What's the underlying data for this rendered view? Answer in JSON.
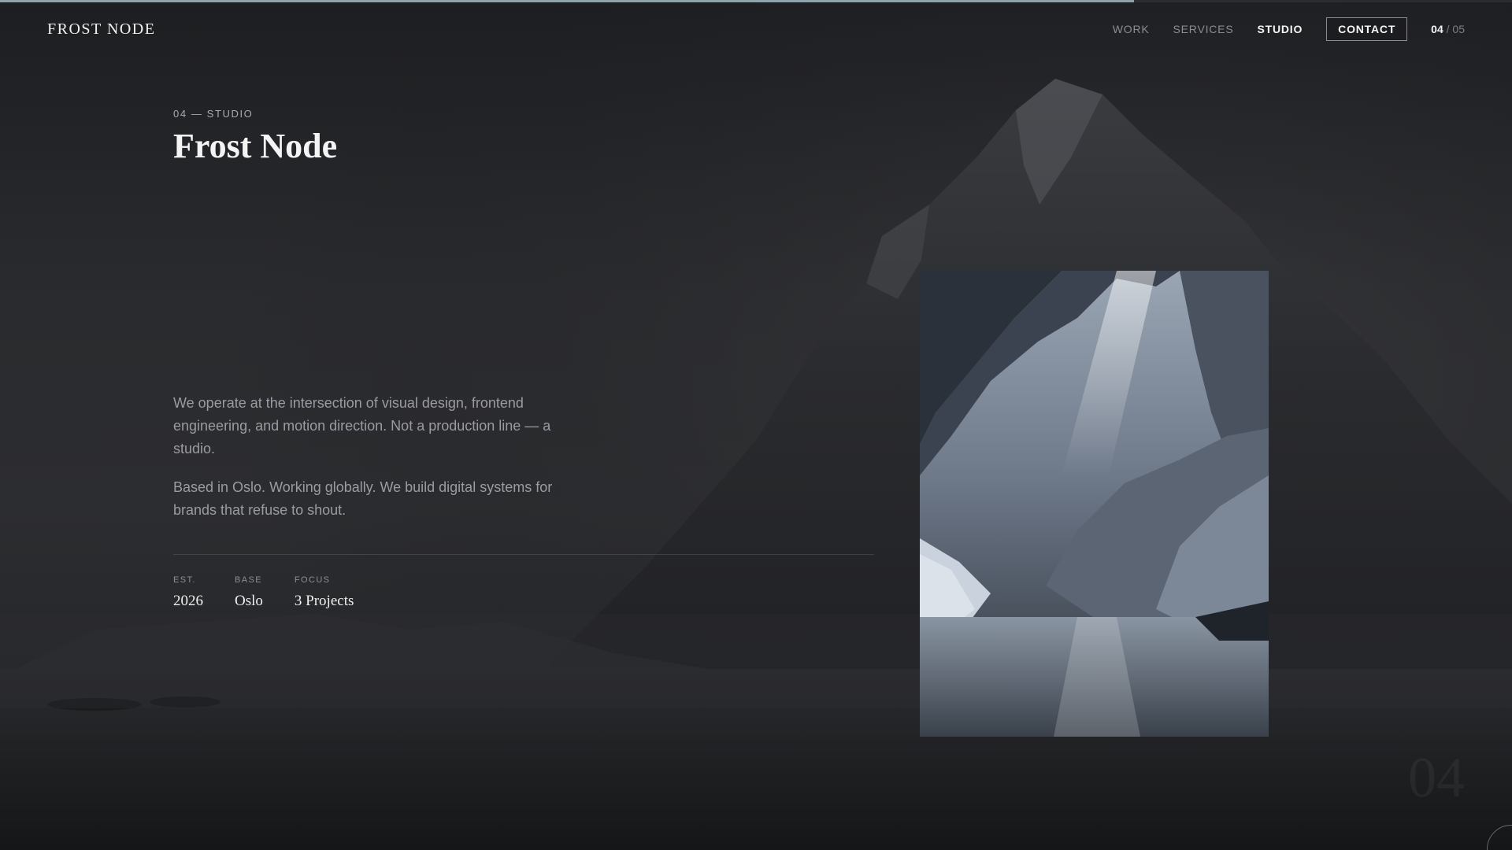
{
  "header": {
    "logo": "FROST NODE",
    "nav": [
      {
        "label": "WORK",
        "active": false
      },
      {
        "label": "SERVICES",
        "active": false
      },
      {
        "label": "STUDIO",
        "active": true
      }
    ],
    "contact_label": "CONTACT",
    "pager": {
      "current": "04",
      "separator": "/",
      "total": "05"
    }
  },
  "progress": {
    "fraction": 0.75,
    "color": "#8fa3a8"
  },
  "hero": {
    "eyebrow": "04 — STUDIO",
    "title": "Frost Node",
    "paragraphs": [
      "We operate at the intersection of visual design, frontend engineering, and motion direction. Not a production line — a studio.",
      "Based in Oslo. Working globally. We build digital systems for brands that refuse to shout."
    ],
    "stats": [
      {
        "label": "EST.",
        "value": "2026"
      },
      {
        "label": "BASE",
        "value": "Oslo"
      },
      {
        "label": "FOCUS",
        "value": "3 Projects"
      }
    ]
  },
  "ghost_number": "04",
  "colors": {
    "background": "#1b1c1f",
    "accent": "#8fa3a8",
    "text": "#f4f4f5",
    "muted": "#9a9ca3"
  }
}
